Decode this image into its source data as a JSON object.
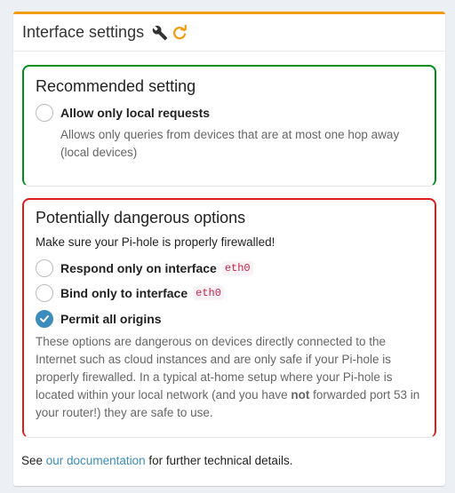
{
  "card": {
    "title": "Interface settings",
    "icons": [
      "wrench-icon",
      "refresh-icon"
    ]
  },
  "recommended": {
    "title": "Recommended setting",
    "option_label": "Allow only local requests",
    "description": "Allows only queries from devices that are at most one hop away (local devices)",
    "selected": false
  },
  "dangerous": {
    "title": "Potentially dangerous options",
    "warning": "Make sure your Pi-hole is properly firewalled!",
    "options": [
      {
        "label": "Respond only on interface",
        "code": "eth0",
        "selected": false
      },
      {
        "label": "Bind only to interface",
        "code": "eth0",
        "selected": false
      },
      {
        "label": "Permit all origins",
        "selected": true
      }
    ],
    "description_part1": "These options are dangerous on devices directly connected to the Internet such as cloud instances and are only safe if your Pi-hole is properly firewalled. In a typical at-home setup where your Pi-hole is located within your local network (and you have ",
    "description_bold": "not",
    "description_part2": " forwarded port 53 in your router!) they are safe to use."
  },
  "footer": {
    "prefix": "See ",
    "link": "our documentation",
    "suffix": " for further technical details."
  },
  "colors": {
    "accent_orange": "#f39c12",
    "recommended_border": "#008d1b",
    "danger_border": "#dd1c1c",
    "checked_radio": "#3c8dbc",
    "link": "#3c8dbc"
  }
}
